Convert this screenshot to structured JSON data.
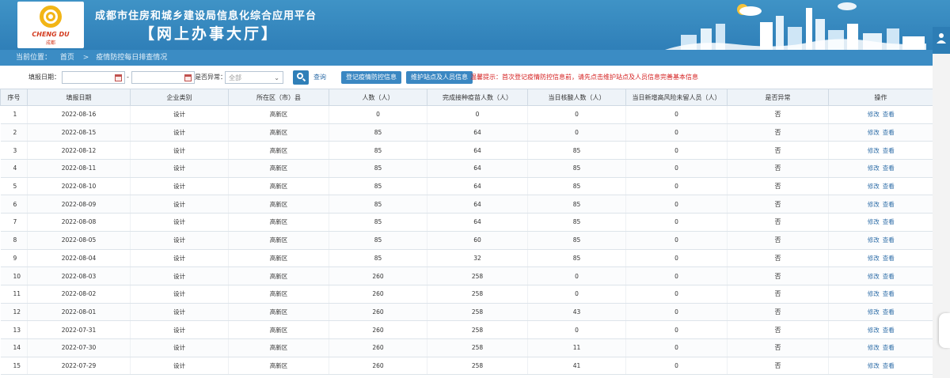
{
  "header": {
    "title": "成都市住房和城乡建设局信息化综合应用平台",
    "subtitle": "【网上办事大厅】",
    "logo_text": "CHENG DU",
    "logo_sub": "成都"
  },
  "breadcrumb": {
    "label": "当前位置：",
    "home": "首页",
    "separator": ">",
    "current": "疫情防控每日排查情况"
  },
  "toolbar": {
    "date_label": "填报日期：",
    "date_from_value": "",
    "date_dash": "-",
    "date_to_value": "",
    "abnormal_label": "是否异常：",
    "abnormal_selected": "全部",
    "query_label": "查询",
    "register_button": "登记疫情防控信息",
    "maintain_button": "维护站点及人员信息",
    "warning_text": "温馨提示：首次登记疫情防控信息前，请先点击维护站点及人员信息完善基本信息"
  },
  "table": {
    "columns": [
      "序号",
      "填报日期",
      "企业类别",
      "所在区（市）县",
      "人数（人）",
      "完成接种疫苗人数（人）",
      "当日核酸人数（人）",
      "当日新增高风险未留人员（人）",
      "是否异常",
      "操作"
    ],
    "action_edit": "修改",
    "action_view": "查看",
    "rows": [
      {
        "no": "1",
        "date": "2022-08-16",
        "type": "设计",
        "district": "高新区",
        "people": "0",
        "vaccinated": "0",
        "tested": "0",
        "new_risk": "0",
        "abnormal": "否"
      },
      {
        "no": "2",
        "date": "2022-08-15",
        "type": "设计",
        "district": "高新区",
        "people": "85",
        "vaccinated": "64",
        "tested": "0",
        "new_risk": "0",
        "abnormal": "否"
      },
      {
        "no": "3",
        "date": "2022-08-12",
        "type": "设计",
        "district": "高新区",
        "people": "85",
        "vaccinated": "64",
        "tested": "85",
        "new_risk": "0",
        "abnormal": "否"
      },
      {
        "no": "4",
        "date": "2022-08-11",
        "type": "设计",
        "district": "高新区",
        "people": "85",
        "vaccinated": "64",
        "tested": "85",
        "new_risk": "0",
        "abnormal": "否"
      },
      {
        "no": "5",
        "date": "2022-08-10",
        "type": "设计",
        "district": "高新区",
        "people": "85",
        "vaccinated": "64",
        "tested": "85",
        "new_risk": "0",
        "abnormal": "否"
      },
      {
        "no": "6",
        "date": "2022-08-09",
        "type": "设计",
        "district": "高新区",
        "people": "85",
        "vaccinated": "64",
        "tested": "85",
        "new_risk": "0",
        "abnormal": "否"
      },
      {
        "no": "7",
        "date": "2022-08-08",
        "type": "设计",
        "district": "高新区",
        "people": "85",
        "vaccinated": "64",
        "tested": "85",
        "new_risk": "0",
        "abnormal": "否"
      },
      {
        "no": "8",
        "date": "2022-08-05",
        "type": "设计",
        "district": "高新区",
        "people": "85",
        "vaccinated": "60",
        "tested": "85",
        "new_risk": "0",
        "abnormal": "否"
      },
      {
        "no": "9",
        "date": "2022-08-04",
        "type": "设计",
        "district": "高新区",
        "people": "85",
        "vaccinated": "32",
        "tested": "85",
        "new_risk": "0",
        "abnormal": "否"
      },
      {
        "no": "10",
        "date": "2022-08-03",
        "type": "设计",
        "district": "高新区",
        "people": "260",
        "vaccinated": "258",
        "tested": "0",
        "new_risk": "0",
        "abnormal": "否"
      },
      {
        "no": "11",
        "date": "2022-08-02",
        "type": "设计",
        "district": "高新区",
        "people": "260",
        "vaccinated": "258",
        "tested": "0",
        "new_risk": "0",
        "abnormal": "否"
      },
      {
        "no": "12",
        "date": "2022-08-01",
        "type": "设计",
        "district": "高新区",
        "people": "260",
        "vaccinated": "258",
        "tested": "43",
        "new_risk": "0",
        "abnormal": "否"
      },
      {
        "no": "13",
        "date": "2022-07-31",
        "type": "设计",
        "district": "高新区",
        "people": "260",
        "vaccinated": "258",
        "tested": "0",
        "new_risk": "0",
        "abnormal": "否"
      },
      {
        "no": "14",
        "date": "2022-07-30",
        "type": "设计",
        "district": "高新区",
        "people": "260",
        "vaccinated": "258",
        "tested": "11",
        "new_risk": "0",
        "abnormal": "否"
      },
      {
        "no": "15",
        "date": "2022-07-29",
        "type": "设计",
        "district": "高新区",
        "people": "260",
        "vaccinated": "258",
        "tested": "41",
        "new_risk": "0",
        "abnormal": "否"
      }
    ]
  },
  "colors": {
    "header_bg": "#2f7fb8",
    "breadcrumb_bg": "#3b8cc4",
    "button_bg": "#3a87c2",
    "warning": "#d42020",
    "link": "#2f6ea8"
  }
}
